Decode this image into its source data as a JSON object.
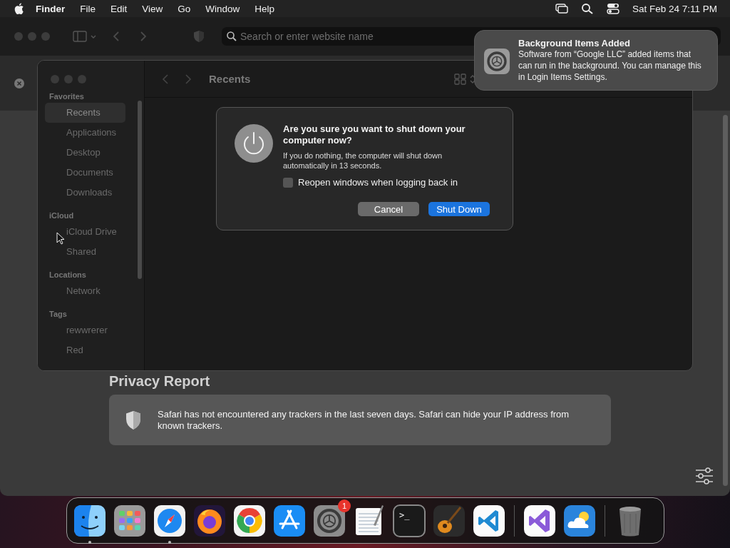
{
  "menubar": {
    "app_name": "Finder",
    "menus": [
      "File",
      "Edit",
      "View",
      "Go",
      "Window",
      "Help"
    ],
    "clock": "Sat Feb 24  7:11 PM"
  },
  "safari": {
    "search": {
      "placeholder": "Search or enter website name"
    },
    "privacy_report": {
      "title": "Privacy Report",
      "text": "Safari has not encountered any trackers in the last seven days. Safari can hide your IP address from known trackers."
    }
  },
  "finder": {
    "title": "Recents",
    "sidebar": [
      {
        "heading": "Favorites",
        "items": [
          {
            "label": "Recents",
            "selected": true
          },
          {
            "label": "Applications",
            "selected": false
          },
          {
            "label": "Desktop",
            "selected": false
          },
          {
            "label": "Documents",
            "selected": false
          },
          {
            "label": "Downloads",
            "selected": false
          }
        ]
      },
      {
        "heading": "iCloud",
        "items": [
          {
            "label": "iCloud Drive",
            "selected": false
          },
          {
            "label": "Shared",
            "selected": false
          }
        ]
      },
      {
        "heading": "Locations",
        "items": [
          {
            "label": "Network",
            "selected": false
          }
        ]
      },
      {
        "heading": "Tags",
        "items": [
          {
            "label": "rewwrerer",
            "selected": false
          },
          {
            "label": "Red",
            "selected": false
          }
        ]
      }
    ]
  },
  "dialog": {
    "title": "Are you sure you want to shut down your computer now?",
    "message": "If you do nothing, the computer will shut down automatically in 13 seconds.",
    "checkbox": {
      "label": "Reopen windows when logging back in",
      "checked": false
    },
    "buttons": [
      {
        "label": "Cancel",
        "kind": "secondary"
      },
      {
        "label": "Shut Down",
        "kind": "primary"
      }
    ]
  },
  "notification": {
    "title": "Background Items Added",
    "body": "Software from “Google LLC” added items that can run in the background. You can manage this in Login Items Settings."
  },
  "dock": {
    "apps": [
      {
        "kind": "finder",
        "running": true
      },
      {
        "kind": "launchpad",
        "running": false
      },
      {
        "kind": "safari",
        "running": true
      },
      {
        "kind": "firefox",
        "running": false
      },
      {
        "kind": "chrome",
        "running": false
      },
      {
        "kind": "appstore",
        "running": false
      },
      {
        "kind": "settings",
        "running": false,
        "badge": "1"
      },
      {
        "kind": "textedit",
        "running": false
      },
      {
        "kind": "terminal",
        "running": false,
        "label": ">_"
      },
      {
        "kind": "garageband",
        "running": false
      },
      {
        "kind": "vscode",
        "running": false
      },
      {
        "kind": "separator"
      },
      {
        "kind": "visualstudio",
        "running": false
      },
      {
        "kind": "weather",
        "running": false
      },
      {
        "kind": "separator"
      },
      {
        "kind": "trash",
        "running": false
      }
    ]
  }
}
